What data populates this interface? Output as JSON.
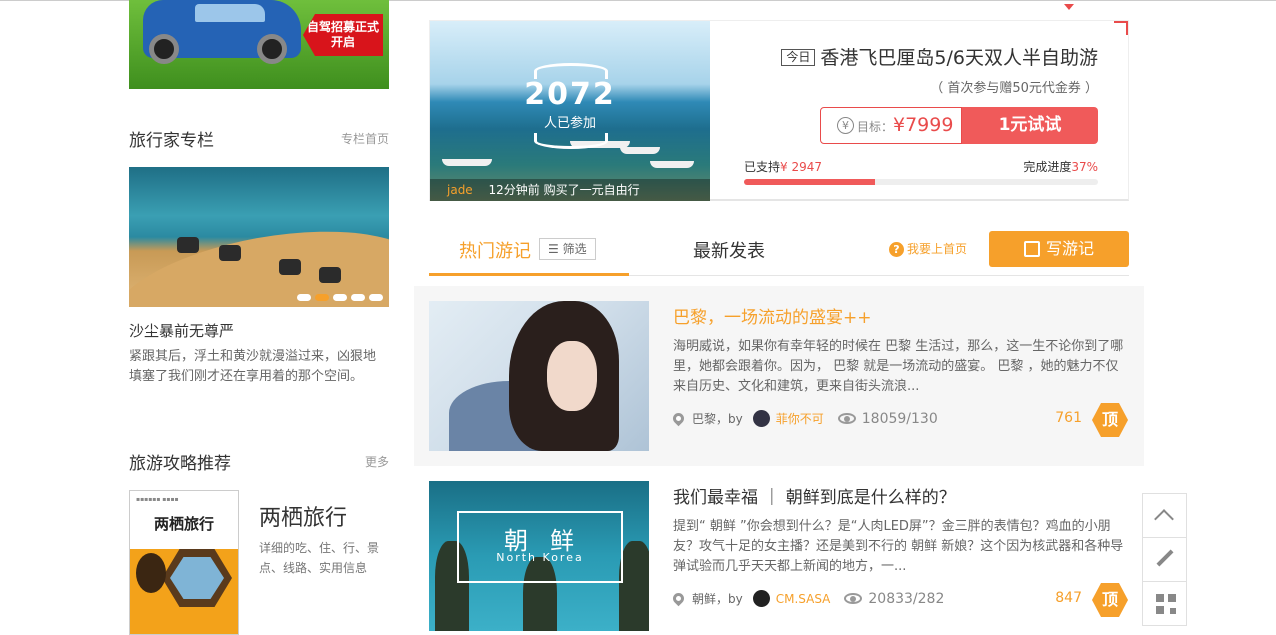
{
  "sidebar": {
    "ad_text": "自驾招募正式开启",
    "travelers": {
      "title": "旅行家专栏",
      "more": "专栏首页",
      "article_title": "沙尘暴前无尊严",
      "article_desc": "紧跟其后，浮土和黄沙就漫溢过来，凶狠地填塞了我们刚才还在享用着的那个空间。"
    },
    "guides": {
      "title": "旅游攻略推荐",
      "more": "更多",
      "cover_name": "两栖旅行",
      "guide_title": "两栖旅行",
      "guide_desc": "详细的吃、住、行、景点、线路、实用信息"
    }
  },
  "promo": {
    "participants": "2072",
    "participants_label": "人已参加",
    "caption_user": "jade",
    "caption_text": "12分钟前 购买了一元自由行",
    "today_badge": "今日",
    "title": "香港飞巴厘岛5/6天双人半自助游",
    "note": "（ 首次参与赠50元代金券 ）",
    "target_label": "目标：",
    "target_value": "¥7999",
    "try_button": "1元试试",
    "supported_label": "已支持",
    "supported_value": "¥ 2947",
    "progress_label": "完成进度",
    "progress_value": "37%",
    "progress_fraction": 0.37,
    "accent": "#f05a5a"
  },
  "tabs": {
    "hot": "热门游记",
    "filter": "筛选",
    "latest": "最新发表",
    "help": "我要上首页",
    "write": "写游记",
    "accent": "#f6a02b"
  },
  "posts": [
    {
      "title": "巴黎，一场流动的盛宴++",
      "desc": "海明威说，如果你有幸年轻的时候在 巴黎 生活过，那么，这一生不论你到了哪里，她都会跟着你。因为， 巴黎 就是一场流动的盛宴。 巴黎 ，她的魅力不仅来自历史、文化和建筑，更来自街头流浪...",
      "location": "巴黎，by",
      "author": "菲你不可",
      "views": "18059/130",
      "votes": "761",
      "ding": "顶"
    },
    {
      "title": "我们最幸福 ｜ 朝鲜到底是什么样的？",
      "desc": "提到“ 朝鲜 ”你会想到什么？是“人肉LED屏”？金三胖的表情包？鸡血的小朋友？攻气十足的女主播？还是美到不行的 朝鲜 新娘？这个因为核武器和各种导弹试验而几乎天天都上新闻的地方，一...",
      "location": "朝鲜，by",
      "author": "CM.SASA",
      "views": "20833/282",
      "votes": "847",
      "ding": "顶",
      "thumb_title": "朝鲜",
      "thumb_sub": "North Korea"
    }
  ],
  "tools": [
    "chevron-up-icon",
    "pencil-icon",
    "qr-code-icon"
  ]
}
